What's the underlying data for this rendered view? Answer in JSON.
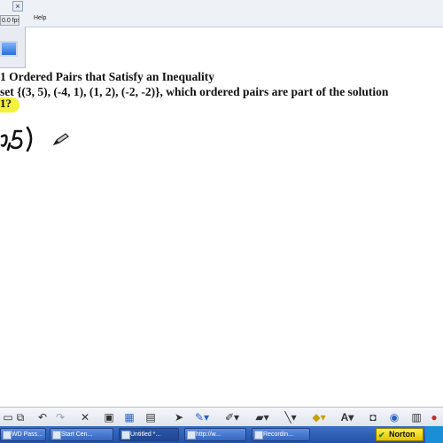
{
  "window": {
    "fps": "0.0 fps",
    "close": "×",
    "menu_help": "Help"
  },
  "whiteboard": {
    "heading_line1": "1 Ordered Pairs that Satisfy an Inequality",
    "heading_line2": "set {(3, 5), (-4, 1), (1, 2), (-2, -2)}, which ordered pairs are part of the solution",
    "highlighted_text": "1?",
    "highlight_color": "#f4f13a",
    "handwritten": ",5)"
  },
  "toolbar": {
    "icons": [
      "new-page-icon",
      "copy-icon",
      "undo-icon",
      "redo-icon",
      "delete-icon",
      "screen-icon",
      "screen-capture-icon",
      "image-icon",
      "select-arrow-icon",
      "pen-icon",
      "highlighter-icon",
      "eraser-icon",
      "line-icon",
      "fill-icon",
      "text-icon",
      "shape-icon",
      "camera-icon",
      "more-icon"
    ]
  },
  "taskbar": {
    "items": [
      {
        "label": "WD Pass..."
      },
      {
        "label": "Start Cen..."
      },
      {
        "label": "Untitled *..."
      },
      {
        "label": "http://w..."
      },
      {
        "label": "Recordin..."
      }
    ],
    "norton": "Norton"
  }
}
